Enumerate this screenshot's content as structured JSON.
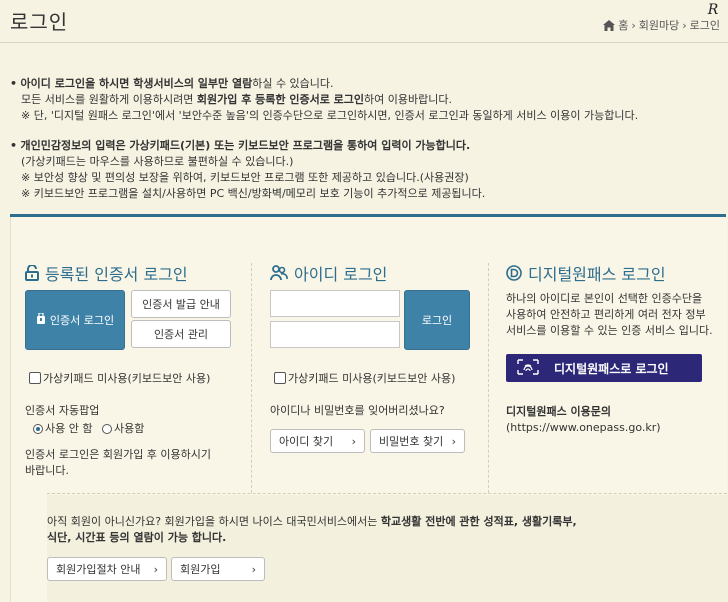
{
  "header": {
    "title": "로그인",
    "breadcrumb": [
      "홈",
      "회원마당",
      "로그인"
    ],
    "corner_mark": "R"
  },
  "notice1": {
    "line1_bullet": "•",
    "line1_a": "아이디 로그인을 하시면 학생서비스의 일부만 열람",
    "line1_b": "하실 수 있습니다.",
    "line2_a": "모든 서비스를 원활하게 이용하시려면 ",
    "line2_b": "회원가입 후 등록한 인증서로 로그인",
    "line2_c": "하여 이용바랍니다.",
    "line3": "※ 단, '디지털 원패스 로그인'에서 '보안수준 높음'의 인증수단으로 로그인하시면, 인증서 로그인과 동일하게 서비스 이용이 가능합니다."
  },
  "notice2": {
    "line1_bullet": "•",
    "line1": "개인민감정보의 입력은 가상키패드(기본) 또는 키보드보안 프로그램을 통하여 입력이 가능합니다.",
    "line2": "(가상키패드는 마우스를 사용하므로 불편하실 수 있습니다.)",
    "line3": "※ 보안성 향상 및 편의성 보장을 위하여, 키보드보안 프로그램 또한 제공하고 있습니다.(사용권장)",
    "line4": "※ 키보드보안 프로그램을 설치/사용하면 PC 백신/방화벽/메모리 보호 기능이 추가적으로 제공됩니다."
  },
  "cert": {
    "title": "등록된 인증서 로그인",
    "login_button": "인증서 로그인",
    "issue_button": "인증서 발급 안내",
    "manage_button": "인증서 관리",
    "keypad_checkbox": "가상키패드 미사용(키보드보안 사용)",
    "popup_label": "인증서 자동팝업",
    "radio_use_not": "사용 안 함",
    "radio_use": "사용함",
    "note_line1": "인증서 로그인은 회원가입 후 이용하시기",
    "note_line2": "바랍니다."
  },
  "id_login": {
    "title": "아이디 로그인",
    "id_value": "",
    "pw_value": "",
    "login_button": "로그인",
    "keypad_checkbox": "가상키패드 미사용(키보드보안 사용)",
    "forgot_text": "아이디나 비밀번호를 잊어버리셨나요?",
    "find_id_button": "아이디 찾기",
    "find_pw_button": "비밀번호 찾기",
    "arrow": "›"
  },
  "onepass": {
    "title": "디지털원패스 로그인",
    "desc1": "하나의 아이디로 본인이 선택한 인증수단을",
    "desc2": "사용하여 안전하고 편리하게 여러 전자 정부",
    "desc3": "서비스를 이용할 수 있는 인증 서비스 입니다.",
    "button": "디지털원패스로 로그인",
    "inquiry_title": "디지털원패스 이용문의",
    "inquiry_url": "(https://www.onepass.go.kr)"
  },
  "join": {
    "line1_a": "아직 회원이 아니신가요? 회원가입을 하시면 나이스 대국민서비스에서는 ",
    "line1_b": "학교생활 전반에 관한 성적표, 생활기록부,",
    "line2_a": "식단, 시간표 등의 열람이 가능 합니다.",
    "guide_button": "회원가입절차 안내",
    "join_button": "회원가입",
    "arrow": "›"
  },
  "colors": {
    "accent": "#2d6e8e",
    "primary_button": "#3f82a8",
    "onepass_button": "#2c2777",
    "background": "#f6f3e3"
  }
}
